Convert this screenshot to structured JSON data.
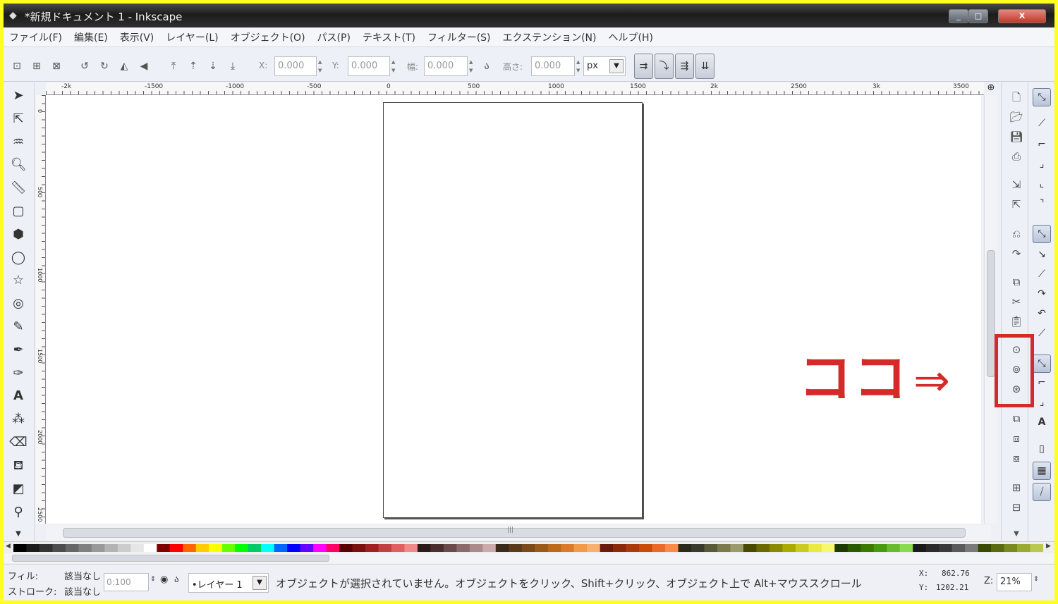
{
  "window": {
    "title": "*新規ドキュメント 1 - Inkscape",
    "minimize": "_",
    "maximize": "□",
    "close": "X"
  },
  "menu": [
    "ファイル(F)",
    "編集(E)",
    "表示(V)",
    "レイヤー(L)",
    "オブジェクト(O)",
    "パス(P)",
    "テキスト(T)",
    "フィルター(S)",
    "エクステンション(N)",
    "ヘルプ(H)"
  ],
  "controls": {
    "x_label": "X:",
    "x_value": "0.000",
    "y_label": "Y:",
    "y_value": "0.000",
    "w_label": "幅:",
    "w_value": "0.000",
    "h_label": "高さ:",
    "h_value": "0.000",
    "unit": "px"
  },
  "ruler": {
    "h_labels": [
      "-2k",
      "-1500",
      "-1000",
      "-500",
      "0",
      "500",
      "1000",
      "1500",
      "2k",
      "2500",
      "3k",
      "3500"
    ],
    "v_labels": [
      "0",
      "500",
      "1000",
      "1500",
      "2000",
      "2500"
    ]
  },
  "annotation": {
    "label": "ココ",
    "arrow": "⇒",
    "color": "#d42a2a"
  },
  "status": {
    "fill_label": "フィル:",
    "fill_value": "該当なし",
    "stroke_label": "ストローク:",
    "stroke_value": "該当なし",
    "opacity": "0:100",
    "layer": "•レイヤー 1",
    "message": "オブジェクトが選択されていません。オブジェクトをクリック、Shift+クリック、オブジェクト上で Alt+マウススクロール",
    "x_label": "X:",
    "x_coord": "862.76",
    "y_label": "Y:",
    "y_coord": "1202.21",
    "zoom_label": "Z:",
    "zoom": "21%"
  },
  "palette": [
    "#000000",
    "#1a1a1a",
    "#333333",
    "#4d4d4d",
    "#666666",
    "#808080",
    "#999999",
    "#b3b3b3",
    "#cccccc",
    "#e6e6e6",
    "#ffffff",
    "#800000",
    "#ff0000",
    "#ff6600",
    "#ffcc00",
    "#ffff00",
    "#66ff00",
    "#00ff00",
    "#00cc66",
    "#00ffff",
    "#0066ff",
    "#0000ff",
    "#6600ff",
    "#ff00ff",
    "#ff0066",
    "#5a0000",
    "#7a1010",
    "#a02020",
    "#c04040",
    "#e06060",
    "#f08a8a",
    "#2a1a1a",
    "#4a2e2e",
    "#6a4a4a",
    "#8a6a6a",
    "#aa8a8a",
    "#caaaaa",
    "#3a2a1a",
    "#5a3a1a",
    "#7a4a1a",
    "#9a5a1a",
    "#ba6a1a",
    "#da7a2a",
    "#f09a4a",
    "#f8b070",
    "#6a1a0a",
    "#8a2a0a",
    "#aa3a0a",
    "#ca4a0a",
    "#ea6a2a",
    "#fa8a4a",
    "#2a2a1a",
    "#3a3a2a",
    "#5a5a3a",
    "#7a7a4a",
    "#9a9a6a",
    "#4a4a00",
    "#6a6a00",
    "#8a8a00",
    "#aaaa00",
    "#caca20",
    "#eaea40",
    "#f8f870",
    "#1a3a00",
    "#2a5a00",
    "#3a7a00",
    "#4a9a10",
    "#6aba30",
    "#8ada50",
    "#1a1a1a",
    "#2a2a2a",
    "#3a3a3a",
    "#5a5a5a",
    "#7a7a7a",
    "#3a4a00",
    "#5a6a10",
    "#7a8a20",
    "#9aaa30",
    "#bac850"
  ]
}
